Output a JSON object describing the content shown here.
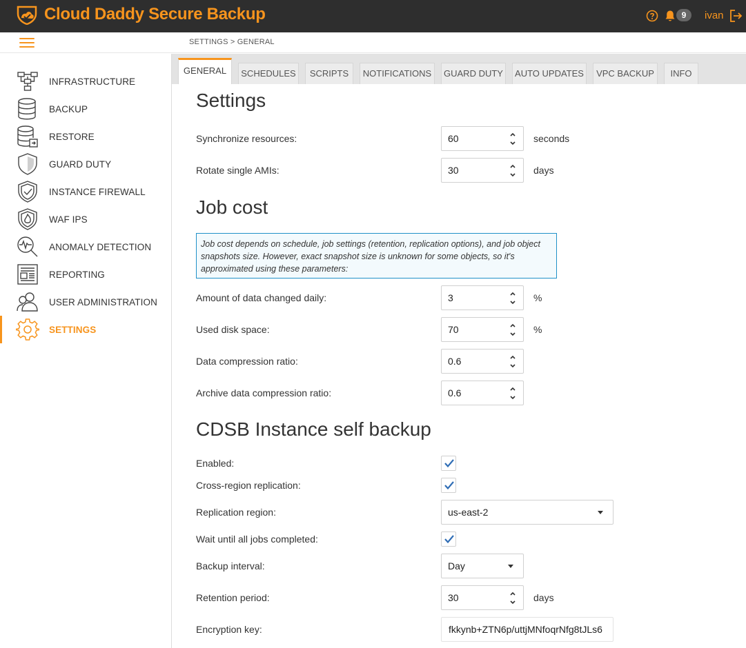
{
  "app": {
    "title": "Cloud Daddy Secure Backup",
    "accent_color": "#f7941d",
    "header_bg": "#2e2e2e",
    "notification_count": "9",
    "username": "ivan"
  },
  "breadcrumb": "SETTINGS > GENERAL",
  "sidebar": {
    "items": [
      {
        "label": "INFRASTRUCTURE",
        "icon": "network-icon"
      },
      {
        "label": "BACKUP",
        "icon": "database-icon"
      },
      {
        "label": "RESTORE",
        "icon": "database-restore-icon"
      },
      {
        "label": "GUARD DUTY",
        "icon": "shield-icon"
      },
      {
        "label": "INSTANCE FIREWALL",
        "icon": "shield-check-icon"
      },
      {
        "label": "WAF IPS",
        "icon": "shield-fire-icon"
      },
      {
        "label": "ANOMALY DETECTION",
        "icon": "magnifier-pulse-icon"
      },
      {
        "label": "REPORTING",
        "icon": "report-icon"
      },
      {
        "label": "USER ADMINISTRATION",
        "icon": "users-icon"
      },
      {
        "label": "SETTINGS",
        "icon": "gear-icon",
        "active": true
      }
    ]
  },
  "tabs": [
    {
      "label": "GENERAL",
      "active": true
    },
    {
      "label": "SCHEDULES"
    },
    {
      "label": "SCRIPTS"
    },
    {
      "label": "NOTIFICATIONS"
    },
    {
      "label": "GUARD DUTY"
    },
    {
      "label": "AUTO UPDATES"
    },
    {
      "label": "VPC BACKUP"
    },
    {
      "label": "INFO"
    }
  ],
  "settings": {
    "title": "Settings",
    "sync_label": "Synchronize resources:",
    "sync_value": "60",
    "sync_unit": "seconds",
    "rotate_label": "Rotate single AMIs:",
    "rotate_value": "30",
    "rotate_unit": "days"
  },
  "job_cost": {
    "title": "Job cost",
    "info": "Job cost depends on schedule, job settings (retention, replication options), and job object snapshots size. However, exact snapshot size is unknown for some objects, so it's approximated using these parameters:",
    "changed_label": "Amount of data changed daily:",
    "changed_value": "3",
    "changed_unit": "%",
    "disk_label": "Used disk space:",
    "disk_value": "70",
    "disk_unit": "%",
    "compression_label": "Data compression ratio:",
    "compression_value": "0.6",
    "archive_label": "Archive data compression ratio:",
    "archive_value": "0.6"
  },
  "self_backup": {
    "title": "CDSB Instance self backup",
    "enabled_label": "Enabled:",
    "enabled": true,
    "cross_region_label": "Cross-region replication:",
    "cross_region": true,
    "region_label": "Replication region:",
    "region_value": "us-east-2",
    "wait_label": "Wait until all jobs completed:",
    "wait": true,
    "interval_label": "Backup interval:",
    "interval_value": "Day",
    "retention_label": "Retention period:",
    "retention_value": "30",
    "retention_unit": "days",
    "key_label": "Encryption key:",
    "key_value": "fkkynb+ZTN6p/uttjMNfoqrNfg8tJLs6"
  }
}
